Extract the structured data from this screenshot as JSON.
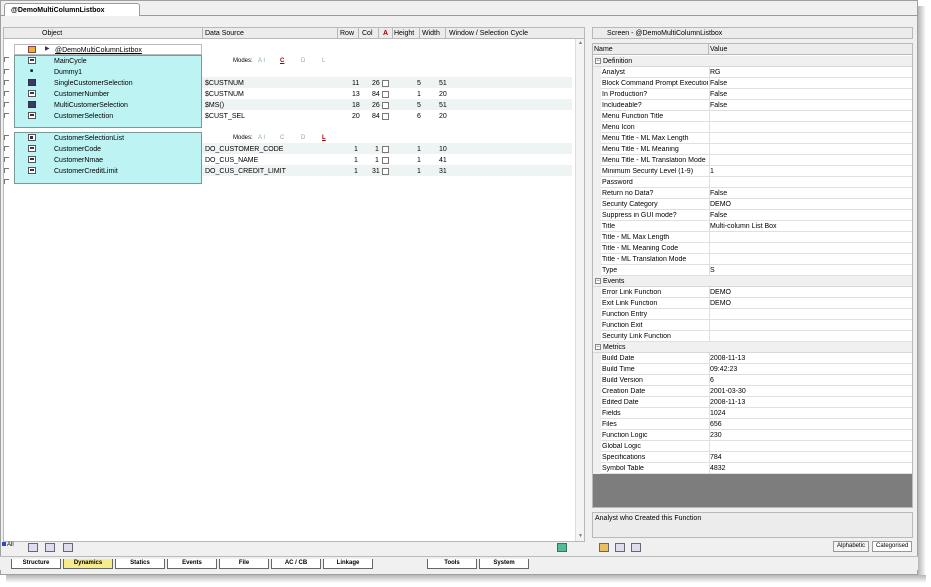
{
  "doc_tab": "@DemoMultiColumnListbox",
  "grid": {
    "headers": [
      "Object",
      "Data Source",
      "Row",
      "Col",
      "A",
      "Height",
      "Width",
      "Window / Selection Cycle"
    ],
    "root": "@DemoMultiColumnListbox",
    "group1": {
      "cycle_name": "MainCycle",
      "modes_label": "Modes:",
      "modes": [
        "A I",
        "C",
        "D",
        "L"
      ],
      "rows": [
        {
          "name": "Dummy1",
          "source": "",
          "row": "",
          "col": "",
          "height": "",
          "width": ""
        },
        {
          "name": "SingleCustomerSelection",
          "source": "$CUSTNUM",
          "row": "11",
          "col": "26",
          "height": "5",
          "width": "51"
        },
        {
          "name": "CustomerNumber",
          "source": "$CUSTNUM",
          "row": "13",
          "col": "84",
          "height": "1",
          "width": "20"
        },
        {
          "name": "MultiCustomerSelection",
          "source": "$MS()",
          "row": "18",
          "col": "26",
          "height": "5",
          "width": "51"
        },
        {
          "name": "CustomerSelection",
          "source": "$CUST_SEL",
          "row": "20",
          "col": "84",
          "height": "6",
          "width": "20"
        }
      ]
    },
    "group2": {
      "list_name": "CustomerSelectionList",
      "modes_label": "Modes:",
      "modes": [
        "A I",
        "C",
        "D",
        "L"
      ],
      "rows": [
        {
          "name": "CustomerCode",
          "source": "DO_CUSTOMER_CODE",
          "row": "1",
          "col": "1",
          "height": "1",
          "width": "10"
        },
        {
          "name": "CustomerNmae",
          "source": "DO_CUS_NAME",
          "row": "1",
          "col": "1",
          "height": "1",
          "width": "41"
        },
        {
          "name": "CustomerCreditLimit",
          "source": "DO_CUS_CREDIT_LIMIT",
          "row": "1",
          "col": "31",
          "height": "1",
          "width": "31"
        }
      ]
    }
  },
  "screen_title": "Screen - @DemoMultiColumnListbox",
  "props": {
    "head_name": "Name",
    "head_value": "Value",
    "categories": [
      {
        "name": "Definition",
        "rows": [
          [
            "Analyst",
            "RG"
          ],
          [
            "Block Command Prompt Execution",
            "False"
          ],
          [
            "In Production?",
            "False"
          ],
          [
            "Includeable?",
            "False"
          ],
          [
            "Menu Function Title",
            ""
          ],
          [
            "Menu Icon",
            ""
          ],
          [
            "Menu Title - ML Max Length",
            ""
          ],
          [
            "Menu Title - ML Meaning",
            ""
          ],
          [
            "Menu Title - ML Translation Mode",
            ""
          ],
          [
            "Minimum Security Level (1-9)",
            "1"
          ],
          [
            "Password",
            ""
          ],
          [
            "Return no Data?",
            "False"
          ],
          [
            "Security Category",
            "DEMO"
          ],
          [
            "Suppress in GUI mode?",
            "False"
          ],
          [
            "Title",
            "Multi-column List Box"
          ],
          [
            "Title - ML Max Length",
            ""
          ],
          [
            "Title - ML Meaning Code",
            ""
          ],
          [
            "Title - ML Translation Mode",
            ""
          ],
          [
            "Type",
            "S"
          ]
        ]
      },
      {
        "name": "Events",
        "rows": [
          [
            "Error Link Function",
            "DEMO"
          ],
          [
            "Exit Link Function",
            "DEMO"
          ],
          [
            "Function Entry",
            ""
          ],
          [
            "Function Exit",
            ""
          ],
          [
            "Security Link Function",
            ""
          ]
        ]
      },
      {
        "name": "Metrics",
        "rows": [
          [
            "Build Date",
            "2008-11-13"
          ],
          [
            "Build Time",
            "09:42:23"
          ],
          [
            "Build Version",
            "6"
          ],
          [
            "Creation Date",
            "2001-03-30"
          ],
          [
            "Edited Date",
            "2008-11-13"
          ],
          [
            "Fields",
            "1024"
          ],
          [
            "Files",
            "656"
          ],
          [
            "Function Logic",
            "230"
          ],
          [
            "Global Logic",
            ""
          ],
          [
            "Specifications",
            "784"
          ],
          [
            "Symbol Table",
            "4832"
          ]
        ]
      }
    ]
  },
  "description": "Analyst who Created this Function",
  "sort_buttons": [
    "Alphabetic",
    "Categorised"
  ],
  "all_label": "All",
  "bottom_tabs": [
    "Structure",
    "Dynamics",
    "Statics",
    "Events",
    "File",
    "AC / CB",
    "Linkage",
    "Tools",
    "System"
  ],
  "active_tab": "Dynamics"
}
